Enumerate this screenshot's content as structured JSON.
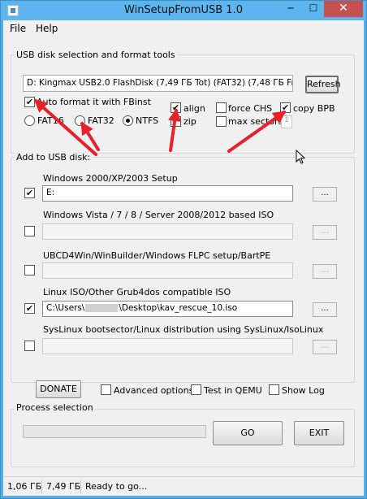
{
  "window": {
    "title": "WinSetupFromUSB 1.0",
    "controls": {
      "minimize": "─",
      "maximize": "☐",
      "close": "✕"
    }
  },
  "menu": {
    "file": "File",
    "help": "Help"
  },
  "usb_section": {
    "label": "USB disk selection and format tools",
    "disk_value": "D: Kingmax USB2.0 FlashDisk (7,49 ГБ Tot) (FAT32) (7,48 ГБ Free",
    "refresh_label": "Refresh",
    "auto_format": {
      "label": "Auto format it with FBinst",
      "checked": true
    },
    "fs_options": [
      {
        "label": "FAT16",
        "checked": false
      },
      {
        "label": "FAT32",
        "checked": false
      },
      {
        "label": "NTFS",
        "checked": true
      }
    ],
    "align": {
      "label": "align",
      "checked": true
    },
    "zip": {
      "label": "zip",
      "checked": false
    },
    "force_chs": {
      "label": "force CHS",
      "checked": false
    },
    "max_sectors": {
      "label": "max sectors",
      "checked": false,
      "value": "1"
    },
    "copy_bpb": {
      "label": "copy BPB",
      "checked": true
    }
  },
  "add_section": {
    "label": "Add to USB disk:",
    "browse_label": "...",
    "sources": [
      {
        "label": "Windows 2000/XP/2003 Setup",
        "checked": true,
        "path": "E:"
      },
      {
        "label": "Windows Vista / 7 / 8 / Server 2008/2012 based ISO",
        "checked": false,
        "path": ""
      },
      {
        "label": "UBCD4Win/WinBuilder/Windows FLPC setup/BartPE",
        "checked": false,
        "path": ""
      },
      {
        "label": "Linux ISO/Other Grub4dos compatible ISO",
        "checked": true,
        "path_prefix": "C:\\Users\\",
        "path_suffix": "\\Desktop\\kav_rescue_10.iso"
      },
      {
        "label": "SysLinux bootsector/Linux distribution using SysLinux/IsoLinux",
        "checked": false,
        "path": ""
      }
    ]
  },
  "options": {
    "donate_label": "DONATE",
    "advanced": {
      "label": "Advanced options",
      "checked": false
    },
    "test_qemu": {
      "label": "Test in QEMU",
      "checked": false
    },
    "show_log": {
      "label": "Show Log",
      "checked": false
    }
  },
  "process": {
    "label": "Process selection",
    "progress": 0,
    "go_label": "GO",
    "exit_label": "EXIT"
  },
  "status": {
    "free": "1,06 ГБ",
    "total": "7,49 ГБ",
    "message": "Ready to go..."
  },
  "colors": {
    "annotation_arrow": "#e8202a",
    "title_bar": "#5cb5ee",
    "close_button": "#c75050"
  }
}
